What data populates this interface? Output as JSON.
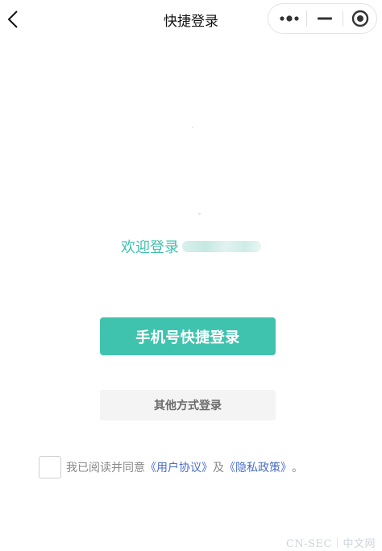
{
  "header": {
    "title": "快捷登录",
    "back_icon": "chevron-left-icon",
    "capsule": {
      "more_icon": "more-dots-icon",
      "minimize_icon": "minimize-icon",
      "close_icon": "target-circle-icon"
    }
  },
  "welcome": {
    "text": "欢迎登录"
  },
  "buttons": {
    "phone_login": "手机号快捷登录",
    "other_login": "其他方式登录"
  },
  "agreement": {
    "prefix": "我已阅读并同意",
    "user_agreement": "《用户协议》",
    "and": "及",
    "privacy_policy": "《隐私政策》",
    "suffix": "。",
    "checked": false
  },
  "watermark": "CN-SEC｜中文网",
  "colors": {
    "accent": "#40c3ae",
    "welcome_text": "#3fc0ad",
    "link": "#4a6fc7",
    "secondary_bg": "#f4f4f4"
  }
}
